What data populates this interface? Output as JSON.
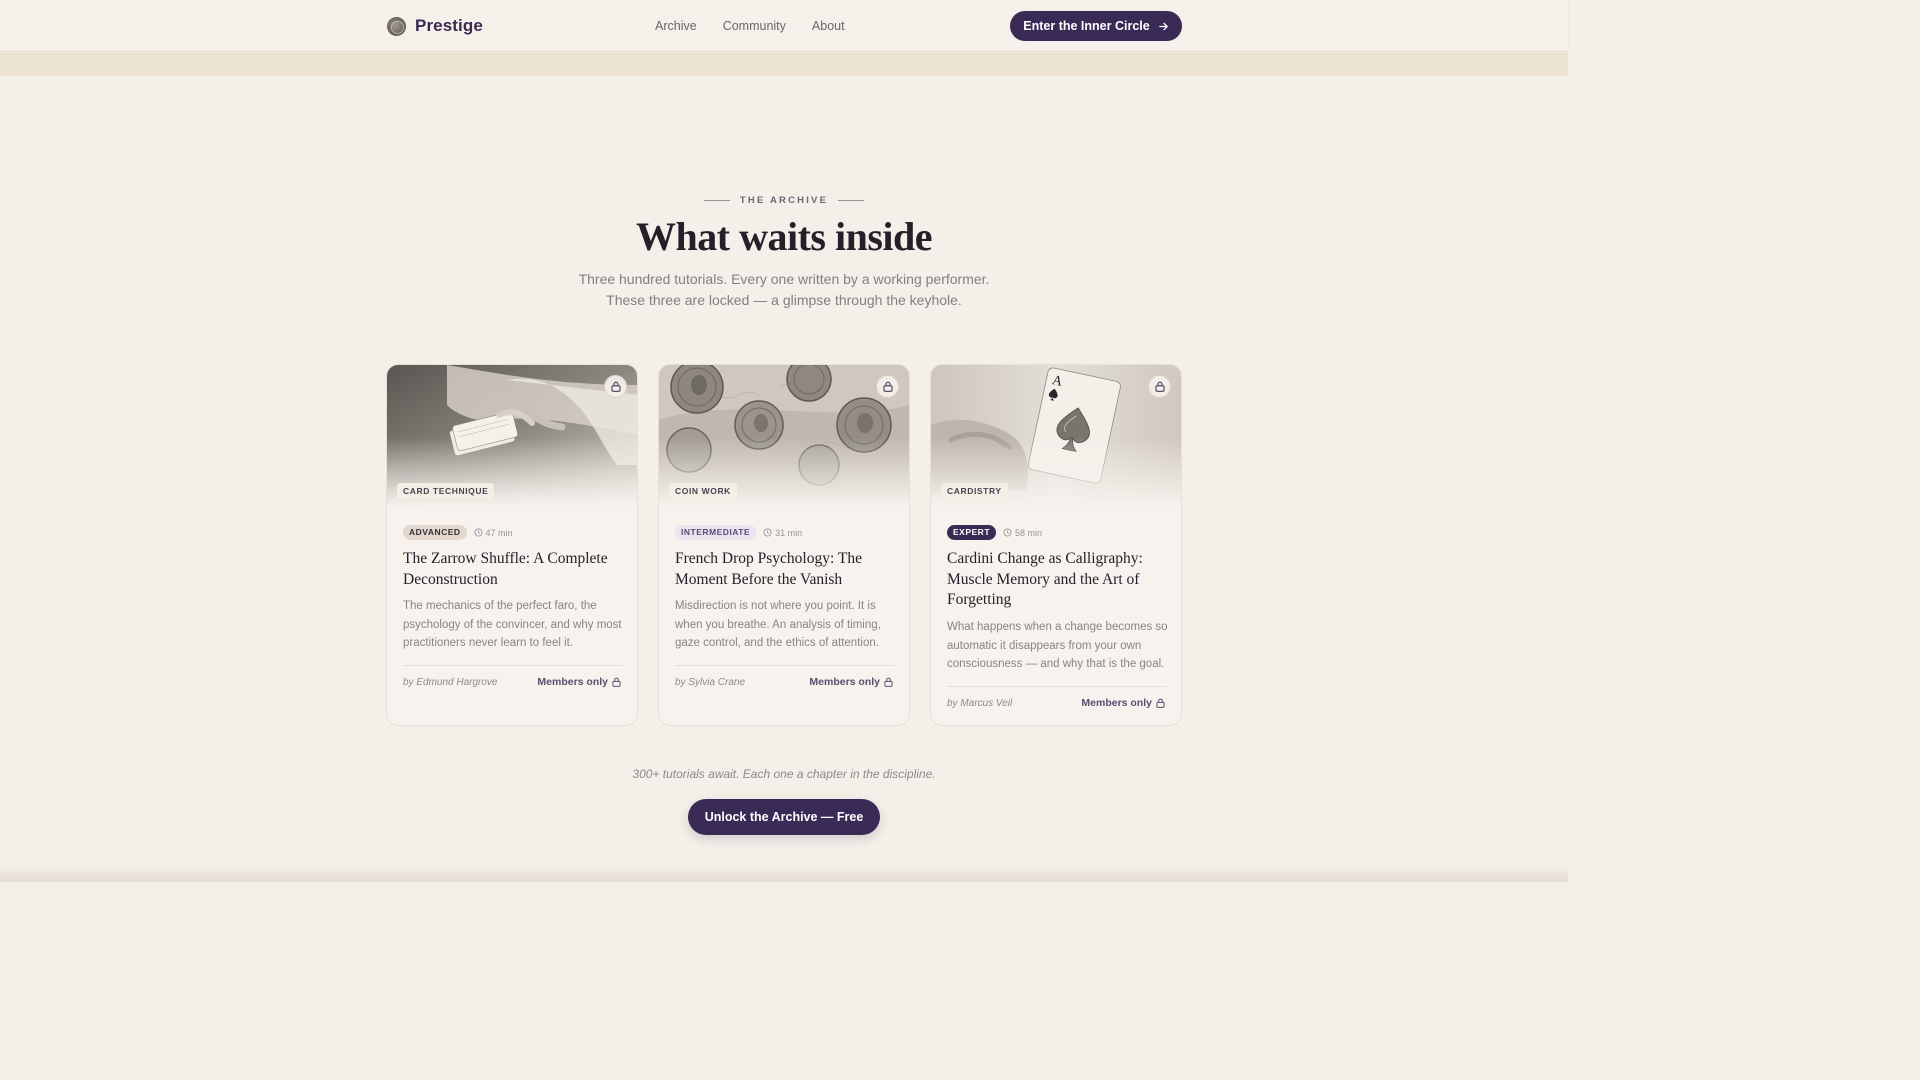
{
  "header": {
    "brand": "Prestige",
    "nav": [
      "Archive",
      "Community",
      "About"
    ],
    "cta_label": "Enter the Inner Circle"
  },
  "section": {
    "eyebrow": "THE ARCHIVE",
    "title": "What waits inside",
    "subtitle_line1": "Three hundred tutorials. Every one written by a working performer.",
    "subtitle_line2": "These three are locked — a glimpse through the keyhole."
  },
  "cards": [
    {
      "category": "CARD TECHNIQUE",
      "level": "ADVANCED",
      "duration": "47 min",
      "title": "The Zarrow Shuffle: A Complete Deconstruction",
      "description": "The mechanics of the perfect faro, the psychology of the convincer, and why most practitioners never learn to feel it.",
      "author": "by Edmund Hargrove",
      "access": "Members only",
      "image": "hands-shuffling-cards"
    },
    {
      "category": "COIN WORK",
      "level": "INTERMEDIATE",
      "duration": "31 min",
      "title": "French Drop Psychology: The Moment Before the Vanish",
      "description": "Misdirection is not where you point. It is when you breathe. An analysis of timing, gaze control, and the ethics of attention.",
      "author": "by Sylvia Crane",
      "access": "Members only",
      "image": "antique-coins"
    },
    {
      "category": "CARDISTRY",
      "level": "EXPERT",
      "duration": "58 min",
      "title": "Cardini Change as Calligraphy: Muscle Memory and the Art of Forgetting",
      "description": "What happens when a change becomes so automatic it disappears from your own consciousness — and why that is the goal.",
      "author": "by Marcus Veil",
      "access": "Members only",
      "image": "hand-holding-ace-of-spades"
    }
  ],
  "footer": {
    "note": "300+ tutorials await. Each one a chapter in the discipline.",
    "cta_label": "Unlock the Archive — Free"
  },
  "colors": {
    "background": "#f4efe8",
    "accent": "#3a2a56",
    "text": "#24202a",
    "muted": "#857d84"
  }
}
